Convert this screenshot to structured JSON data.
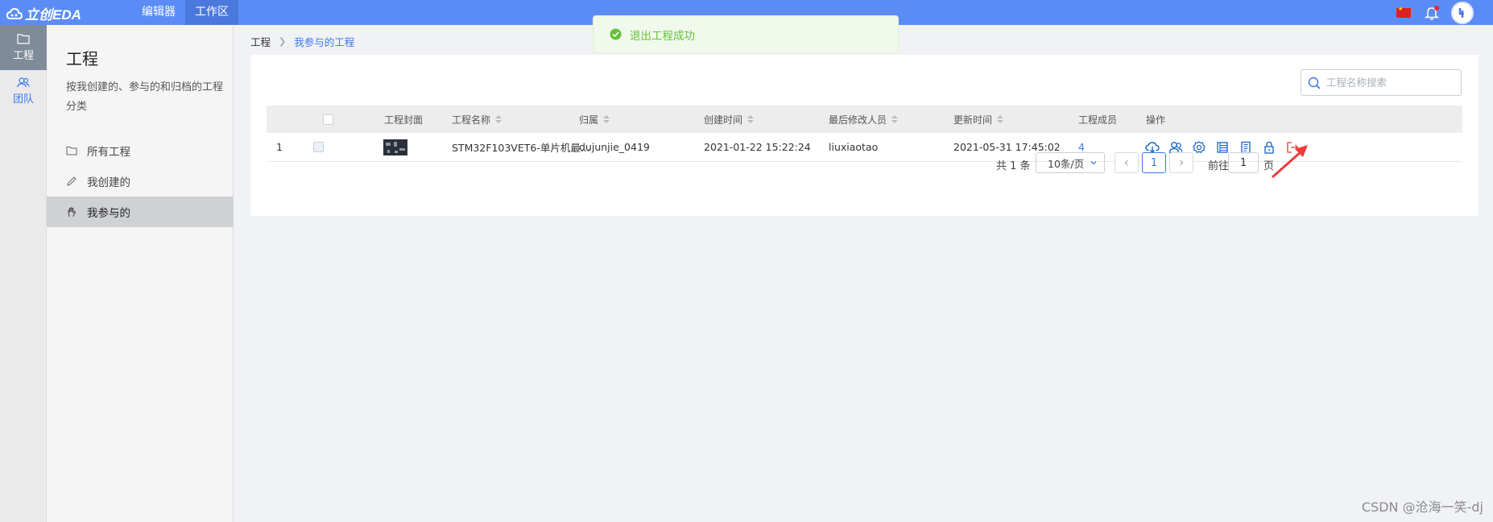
{
  "topbar": {
    "logo_text": "立创EDA",
    "nav": [
      "编辑器",
      "工作区"
    ],
    "active_nav": 1,
    "avatar_text": "",
    "brand_color": "#5b8cf5"
  },
  "rail": {
    "items": [
      {
        "label": "工程",
        "icon": "folder-icon",
        "active": true
      },
      {
        "label": "团队",
        "icon": "team-icon",
        "active": false
      }
    ]
  },
  "sidebar": {
    "title": "工程",
    "description": "按我创建的、参与的和归档的工程分类",
    "items": [
      {
        "label": "所有工程",
        "icon": "folder-icon"
      },
      {
        "label": "我创建的",
        "icon": "pencil-icon"
      },
      {
        "label": "我参与的",
        "icon": "hand-icon",
        "active": true
      }
    ]
  },
  "breadcrumb": {
    "root": "工程",
    "current": "我参与的工程"
  },
  "search": {
    "placeholder": "工程名称搜索",
    "value": ""
  },
  "table": {
    "headers": {
      "cover": "工程封面",
      "name": "工程名称",
      "owner": "归属",
      "created": "创建时间",
      "modifier": "最后修改人员",
      "updated": "更新时间",
      "members": "工程成员",
      "ops": "操作"
    },
    "rows": [
      {
        "index": "1",
        "name": "STM32F103VET6-单片机最...",
        "owner": "dujunjie_0419",
        "created": "2021-01-22 15:22:24",
        "modifier": "liuxiaotao",
        "updated": "2021-05-31 17:45:02",
        "members": "4"
      }
    ],
    "operation_icons": [
      "cloud-download-icon",
      "members-icon",
      "settings-icon",
      "list-icon",
      "document-icon",
      "lock-icon",
      "exit-icon"
    ]
  },
  "pagination": {
    "total": "共 1 条",
    "page_size": "10条/页",
    "current_page": "1",
    "goto_label": "前往",
    "goto_value": "1",
    "page_unit": "页"
  },
  "toast": {
    "message": "退出工程成功",
    "color": "#67c23a"
  },
  "watermark": "CSDN @沧海一笑-dj"
}
